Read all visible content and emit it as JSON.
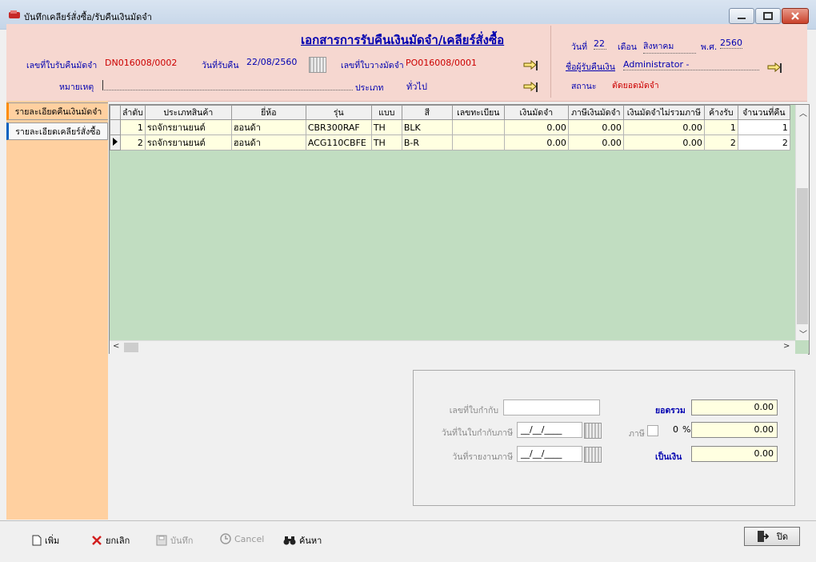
{
  "window": {
    "title": "บันทึกเคลียร์สั่งซื้อ/รับคืนเงินมัดจำ"
  },
  "header": {
    "doc_title": "เอกสารการรับคืนเงินมัดจำ/เคลียร์สั่งซื้อ",
    "refund_no_label": "เลขที่ใบรับคืนมัดจำ",
    "refund_no_value": "DN016008/0002",
    "refund_date_label": "วันที่รับคืน",
    "refund_date_value": "22/08/2560",
    "deposit_no_label": "เลขที่ใบวางมัดจำ",
    "deposit_no_value": "PO016008/0001",
    "note_label": "หมายเหตุ",
    "type_label": "ประเภท",
    "type_value": "ทั่วไป",
    "day_label": "วันที่",
    "day_value": "22",
    "month_label": "เดือน",
    "month_value": "สิงหาคม",
    "year_label": "พ.ศ.",
    "year_value": "2560",
    "receiver_label": "ชื่อผู้รับคืนเงิน",
    "receiver_value": "Administrator -",
    "status_label": "สถานะ",
    "status_value": "ตัดยอดมัดจำ"
  },
  "tabs": [
    {
      "label": "รายละเอียดคืนเงินมัดจำ"
    },
    {
      "label": "รายละเอียดเคลียร์สั่งซื้อ"
    }
  ],
  "grid": {
    "columns": [
      "ลำดับ",
      "ประเภทสินค้า",
      "ยี่ห้อ",
      "รุ่น",
      "แบบ",
      "สี",
      "เลขทะเบียน",
      "เงินมัดจำ",
      "ภาษีเงินมัดจำ",
      "เงินมัดจำไม่รวมภาษี",
      "ค้างรับ",
      "จำนวนที่คืน"
    ],
    "rows": [
      [
        "1",
        "รถจักรยานยนต์",
        "ฮอนด้า",
        "CBR300RAF",
        "TH",
        "BLK",
        "",
        "0.00",
        "0.00",
        "0.00",
        "1",
        "1"
      ],
      [
        "2",
        "รถจักรยานยนต์",
        "ฮอนด้า",
        "ACG110CBFE",
        "TH",
        "B-R",
        "",
        "0.00",
        "0.00",
        "0.00",
        "2",
        "2"
      ]
    ]
  },
  "totals": {
    "tax_invoice_no_label": "เลขที่ใบกำกับ",
    "tax_invoice_date_label": "วันที่ในใบกำกับภาษี",
    "tax_invoice_date_value": "__/__/____",
    "tax_report_date_label": "วันที่รายงานภาษี",
    "tax_report_date_value": "__/__/____",
    "sum_label": "ยอดรวม",
    "sum_value": "0.00",
    "tax_label": "ภาษี",
    "tax_rate_value": "0",
    "tax_rate_unit": "%",
    "tax_value": "0.00",
    "net_label": "เป็นเงิน",
    "net_value": "0.00"
  },
  "toolbar": {
    "add_label": "เพิ่ม",
    "cancel_doc_label": "ยกเลิก",
    "save_label": "บันทึก",
    "cancel_label": "Cancel",
    "search_label": "ค้นหา",
    "close_label": "ปิด"
  },
  "colors": {
    "header_bg": "#f6d7d0",
    "left_panel_bg": "#ffd0a0",
    "grid_bg": "#c1ddc1",
    "row_bg": "#ffffe1",
    "label_blue": "#0000b0",
    "value_red": "#cc0000"
  }
}
